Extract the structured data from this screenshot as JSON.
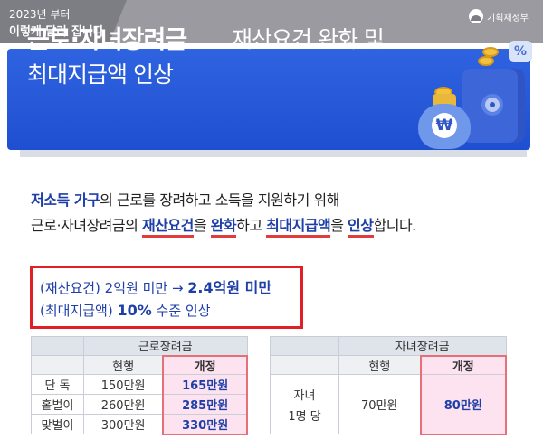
{
  "header": {
    "year_text": "2023년 부터",
    "subtitle": "이렇게 달라 집니다",
    "ministry": "기획재정부"
  },
  "banner": {
    "title_strong": "근로·자녀장려금",
    "title_rest": "재산요건 완화 및",
    "title_line2": "최대지급액 인상",
    "bag_symbol": "₩",
    "percent_symbol": "%"
  },
  "intro": {
    "l1_a": "저소득 가구",
    "l1_b": "의 근로를 장려하고 소득을 지원하기 위해",
    "l2_a": "근로·자녀장려금의 ",
    "l2_b": "재산요건",
    "l2_c": "을 ",
    "l2_d": "완화",
    "l2_e": "하고 ",
    "l2_f": "최대지급액",
    "l2_g": "을 ",
    "l2_h": "인상",
    "l2_i": "합니다."
  },
  "highlight": {
    "l1_a": "(재산요건) 2억원 미만 → ",
    "l1_b": "2.4억원 미만",
    "l2_a": "(최대지급액) ",
    "l2_b": "10%",
    "l2_c": " 수준 인상"
  },
  "table1": {
    "title": "근로장려금",
    "col_current": "현행",
    "col_revised": "개정",
    "rows": [
      {
        "label": "단 독",
        "current": "150만원",
        "revised": "165만원"
      },
      {
        "label": "홑벌이",
        "current": "260만원",
        "revised": "285만원"
      },
      {
        "label": "맞벌이",
        "current": "300만원",
        "revised": "330만원"
      }
    ]
  },
  "table2": {
    "title": "자녀장려금",
    "col_current": "현행",
    "col_revised": "개정",
    "row_label_1": "자녀",
    "row_label_2": "1명 당",
    "current": "70만원",
    "revised": "80만원"
  },
  "colors": {
    "banner_blue": "#2f63e0",
    "accent_navy": "#1f3fa8",
    "highlight_red": "#e31f26",
    "revised_pink": "#fde3ef"
  }
}
